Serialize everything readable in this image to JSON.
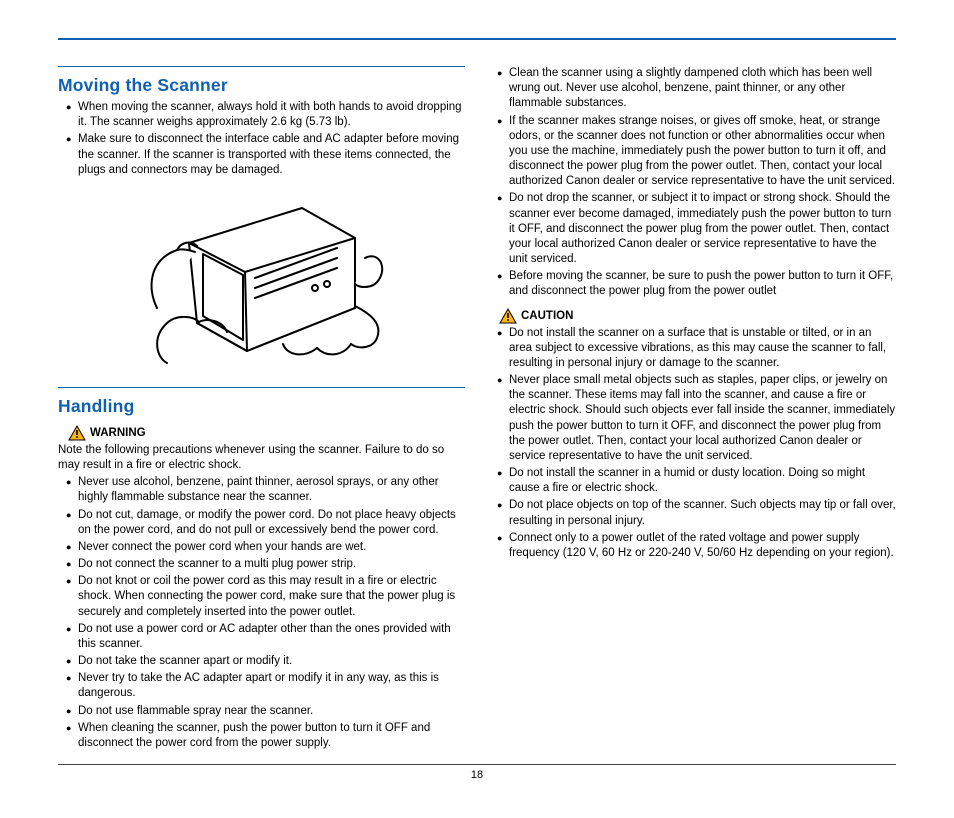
{
  "page_number": "18",
  "sections": {
    "moving": {
      "title": "Moving the Scanner",
      "items": [
        "When moving the scanner, always hold it with both hands to avoid dropping it. The scanner weighs approximately 2.6 kg (5.73 lb).",
        "Make sure to disconnect the interface cable and AC adapter before moving the scanner. If the scanner is transported with these items connected, the plugs and connectors may be damaged."
      ]
    },
    "handling": {
      "title": "Handling",
      "warn_label": "WARNING",
      "note": "Note the following precautions whenever using the scanner. Failure to do so may result in a fire or electric shock.",
      "items": [
        "Never use alcohol, benzene, paint thinner, aerosol sprays, or any other highly flammable substance near the scanner.",
        "Do not cut, damage, or modify the power cord. Do not place heavy objects on the power cord, and do not pull or excessively bend the power cord.",
        "Never connect the power cord when your hands are wet.",
        "Do not connect the scanner to a multi plug power strip.",
        "Do not knot or coil the power cord as this may result in a fire or electric shock. When connecting the power cord, make sure that the power plug is securely and completely inserted into the power outlet.",
        "Do not use a power cord or AC adapter other than the ones provided with this scanner.",
        "Do not take the scanner apart or modify it.",
        "Never try to take the AC adapter apart or modify it in any way, as this is dangerous.",
        "Do not use flammable spray near the scanner.",
        "When cleaning the scanner, push the power button to turn it OFF and disconnect the power cord from the power supply.",
        "Clean the scanner using a slightly dampened cloth which has been well wrung out. Never use alcohol, benzene, paint thinner, or any other flammable substances.",
        "If the scanner makes strange noises, or gives off smoke, heat, or strange odors, or the scanner does not function or other abnormalities occur when you use the machine, immediately push the power button to turn it off, and disconnect the power plug from the power outlet. Then, contact your local authorized Canon dealer or service representative to have the unit serviced.",
        "Do not drop the scanner, or subject it to impact or strong shock. Should the scanner ever become damaged, immediately push the power button to turn it OFF, and disconnect the power plug from the power outlet. Then, contact your local authorized Canon dealer or service representative to have the unit serviced.",
        "Before moving the scanner, be sure to push the power button to turn it OFF, and disconnect the power plug from the power outlet"
      ],
      "caution_label": "CAUTION",
      "caution_items": [
        "Do not install the scanner on a surface that is unstable or tilted, or in an area subject to excessive vibrations, as this may cause the scanner to fall, resulting in personal injury or damage to the scanner.",
        "Never place small metal objects such as staples, paper clips, or jewelry on the scanner. These items may fall into the scanner, and cause a fire or electric shock. Should such objects ever fall inside the scanner, immediately push the power button to turn it OFF, and disconnect the power plug from the power outlet. Then, contact your local authorized Canon dealer or service representative to have the unit serviced.",
        "Do not install the scanner in a humid or dusty location. Doing so might cause a fire or electric shock.",
        "Do not place objects on top of the scanner. Such objects may tip or fall over, resulting in personal injury.",
        "Connect only to a power outlet of the rated voltage and power supply frequency (120 V, 60 Hz or 220-240 V, 50/60 Hz depending on your region)."
      ]
    }
  }
}
